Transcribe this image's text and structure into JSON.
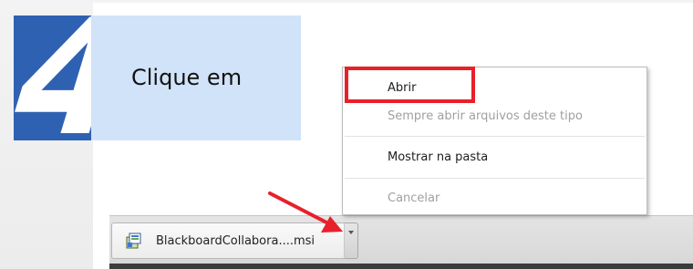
{
  "step": {
    "number": "4"
  },
  "instruction": {
    "text": "Clique em"
  },
  "context_menu": {
    "items": [
      {
        "label": "Abrir",
        "enabled": true
      },
      {
        "label": "Sempre abrir arquivos deste tipo",
        "enabled": false
      },
      {
        "label": "Mostrar na pasta",
        "enabled": true
      },
      {
        "label": "Cancelar",
        "enabled": false
      }
    ]
  },
  "download": {
    "file_name": "BlackboardCollabora....msi"
  },
  "colors": {
    "step_block": "#2f61b3",
    "instruction_box": "#d1e3f8",
    "highlight": "#e8202a",
    "arrow": "#e8202a"
  },
  "icons": {
    "file": "installer-file-icon",
    "dropdown": "chevron-down-icon",
    "pointer": "red-arrow"
  }
}
